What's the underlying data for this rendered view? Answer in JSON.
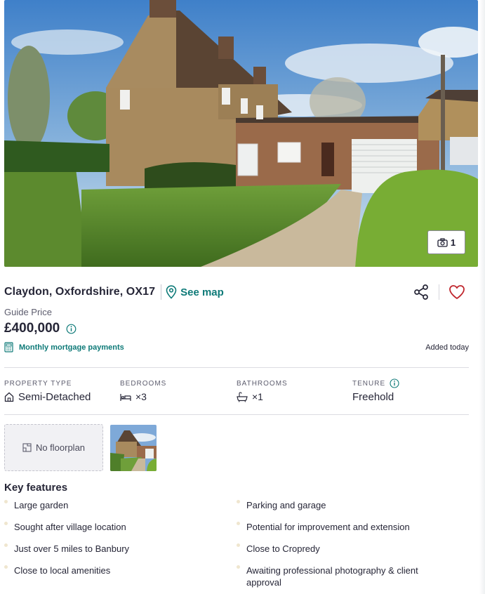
{
  "listing": {
    "address": "Claydon, Oxfordshire, OX17",
    "see_map_label": "See map",
    "price_qualifier": "Guide Price",
    "price": "£400,000",
    "mortgage_label": "Monthly mortgage payments",
    "added": "Added today",
    "photo_count": "1"
  },
  "stats": {
    "property_type": {
      "label": "PROPERTY TYPE",
      "value": "Semi-Detached",
      "icon": "house-icon"
    },
    "bedrooms": {
      "label": "BEDROOMS",
      "value": "×3",
      "icon": "bed-icon"
    },
    "bathrooms": {
      "label": "BATHROOMS",
      "value": "×1",
      "icon": "bath-icon"
    },
    "tenure": {
      "label": "TENURE",
      "value": "Freehold",
      "icon": "info-icon"
    }
  },
  "media": {
    "no_floorplan_label": "No floorplan"
  },
  "key_features": {
    "title": "Key features",
    "left": [
      "Large garden",
      "Sought after village location",
      "Just over 5 miles to Banbury",
      "Close to local amenities"
    ],
    "right": [
      "Parking and garage",
      "Potential for improvement and extension",
      "Close to Cropredy",
      "Awaiting professional photography & client approval"
    ]
  },
  "colors": {
    "accent_teal": "#0e7a78",
    "heart_red": "#c0262d",
    "text_dark": "#262637"
  }
}
